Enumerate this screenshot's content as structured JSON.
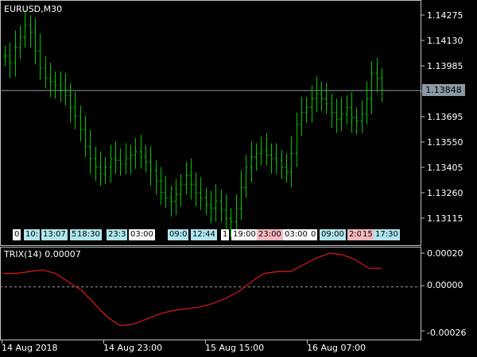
{
  "window": {
    "symbol_title": "EURUSD,M30",
    "indicator_title": "TRIX(14) 0.00007"
  },
  "price_axis": {
    "labels": [
      "1.14275",
      "1.14130",
      "1.13985",
      "1.13695",
      "1.13550",
      "1.13405",
      "1.13260",
      "1.13115"
    ],
    "current_price": "1.13848"
  },
  "indicator_axis": {
    "labels": [
      "0.00020",
      "0.00000",
      "-0.00026"
    ]
  },
  "time_axis": {
    "labels": [
      "14 Aug 2018",
      "14 Aug 23:00",
      "15 Aug 15:00",
      "16 Aug 07:00"
    ]
  },
  "session_tags": [
    {
      "text": "0",
      "color": "white"
    },
    {
      "text": "10:",
      "color": "blue"
    },
    {
      "text": "13:07",
      "color": "blue"
    },
    {
      "text": "5",
      "color": "blue"
    },
    {
      "text": "18:30",
      "color": "blue"
    },
    {
      "text": "23:3",
      "color": "blue"
    },
    {
      "text": "03:00",
      "color": "white"
    },
    {
      "text": "09:0",
      "color": "blue"
    },
    {
      "text": "12:44",
      "color": "blue"
    },
    {
      "text": "1",
      "color": "white"
    },
    {
      "text": "19:00",
      "color": "white"
    },
    {
      "text": "23:00",
      "color": "pink"
    },
    {
      "text": "03:00",
      "color": "white"
    },
    {
      "text": "0",
      "color": "white"
    },
    {
      "text": "09:00",
      "color": "blue"
    },
    {
      "text": "2:0",
      "color": "pink"
    },
    {
      "text": "15",
      "color": "pink"
    },
    {
      "text": "17:30",
      "color": "blue"
    }
  ],
  "colors": {
    "bars": "#00c800",
    "trix_line": "#e01818",
    "grid_frame": "#c0c0c0",
    "current_price_bg": "#8c9aa6"
  },
  "chart_data": {
    "type": "line",
    "bars_close": [
      1.1405,
      1.1401,
      1.141,
      1.1416,
      1.1423,
      1.1419,
      1.1408,
      1.1398,
      1.1392,
      1.139,
      1.1388,
      1.1385,
      1.1382,
      1.1375,
      1.137,
      1.1362,
      1.1352,
      1.1345,
      1.134,
      1.1336,
      1.134,
      1.1345,
      1.1344,
      1.1342,
      1.1345,
      1.1347,
      1.1349,
      1.1346,
      1.1343,
      1.1338,
      1.1332,
      1.1325,
      1.1322,
      1.132,
      1.1324,
      1.133,
      1.1335,
      1.133,
      1.1325,
      1.1322,
      1.1318,
      1.1316,
      1.132,
      1.1315,
      1.131,
      1.1308,
      1.1316,
      1.1328,
      1.134,
      1.1346,
      1.1348,
      1.135,
      1.1347,
      1.1345,
      1.1344,
      1.134,
      1.1337,
      1.1348,
      1.1365,
      1.1372,
      1.1375,
      1.138,
      1.1383,
      1.138,
      1.1377,
      1.1372,
      1.1368,
      1.1371,
      1.1375,
      1.1369,
      1.1367,
      1.1371,
      1.138,
      1.1395,
      1.1392,
      1.1385
    ],
    "price_ylim": [
      1.1305,
      1.1435
    ],
    "trix_values": [
      8e-05,
      8e-05,
      9e-05,
      0.0001,
      8e-05,
      3e-05,
      -2e-05,
      -0.0001,
      -0.00018,
      -0.00023,
      -0.00022,
      -0.00019,
      -0.00016,
      -0.00014,
      -0.00013,
      -0.00012,
      -0.0001,
      -7e-05,
      -3e-05,
      3e-05,
      8e-05,
      9e-05,
      9e-05,
      0.00013,
      0.00017,
      0.0002,
      0.00019,
      0.00016,
      0.00011,
      0.00011
    ],
    "trix_ylim": [
      -0.00026,
      0.0002
    ],
    "title": "EURUSD,M30",
    "indicator": "TRIX(14) 0.00007"
  }
}
